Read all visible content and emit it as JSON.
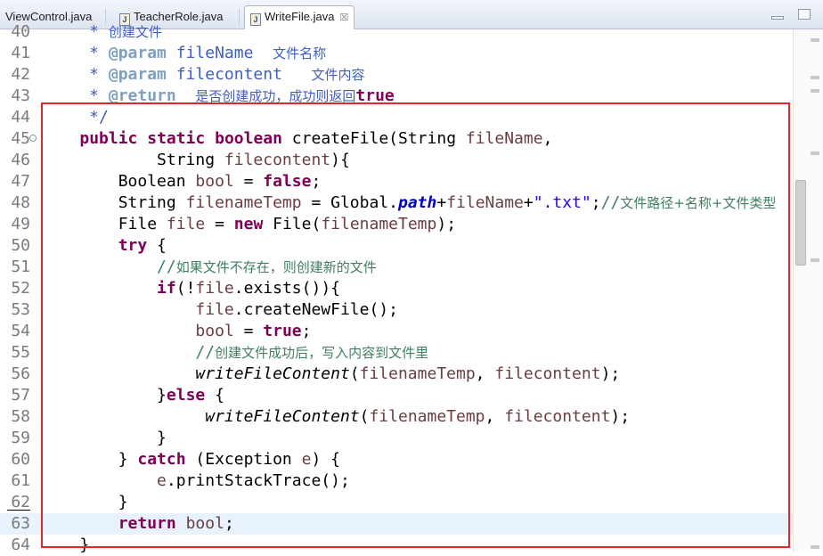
{
  "tabs": [
    {
      "label": "ViewControl.java"
    },
    {
      "label": "TeacherRole.java"
    },
    {
      "label": "WriteFile.java",
      "close": "☒"
    }
  ],
  "lines": [
    {
      "num": "40",
      "parts": [
        {
          "c": "doc",
          "t": "     * "
        },
        {
          "c": "dtxt",
          "t": "创建文件"
        }
      ]
    },
    {
      "num": "41",
      "parts": [
        {
          "c": "doc",
          "t": "     * "
        },
        {
          "c": "dtag",
          "t": "@param"
        },
        {
          "c": "doc",
          "t": " fileName  "
        },
        {
          "c": "dtxt",
          "t": "文件名称"
        }
      ]
    },
    {
      "num": "42",
      "parts": [
        {
          "c": "doc",
          "t": "     * "
        },
        {
          "c": "dtag",
          "t": "@param"
        },
        {
          "c": "doc",
          "t": " filecontent   "
        },
        {
          "c": "dtxt",
          "t": "文件内容"
        }
      ]
    },
    {
      "num": "43",
      "parts": [
        {
          "c": "doc",
          "t": "     * "
        },
        {
          "c": "dtag",
          "t": "@return"
        },
        {
          "c": "doc",
          "t": "  "
        },
        {
          "c": "dtxt",
          "t": "是否创建成功，成功则返回"
        },
        {
          "c": "kw",
          "t": "true"
        }
      ]
    },
    {
      "num": "44",
      "parts": [
        {
          "c": "doc",
          "t": "     */"
        }
      ]
    },
    {
      "num": "45",
      "fold": "⊖",
      "parts": [
        {
          "c": "",
          "t": "    "
        },
        {
          "c": "kw",
          "t": "public"
        },
        {
          "c": "",
          "t": " "
        },
        {
          "c": "kw",
          "t": "static"
        },
        {
          "c": "",
          "t": " "
        },
        {
          "c": "kw",
          "t": "boolean"
        },
        {
          "c": "",
          "t": " createFile(String "
        },
        {
          "c": "param",
          "t": "fileName"
        },
        {
          "c": "",
          "t": ","
        }
      ]
    },
    {
      "num": "46",
      "parts": [
        {
          "c": "",
          "t": "            String "
        },
        {
          "c": "param",
          "t": "filecontent"
        },
        {
          "c": "",
          "t": "){"
        }
      ]
    },
    {
      "num": "47",
      "parts": [
        {
          "c": "",
          "t": "        Boolean "
        },
        {
          "c": "param",
          "t": "bool"
        },
        {
          "c": "",
          "t": " = "
        },
        {
          "c": "kw",
          "t": "false"
        },
        {
          "c": "",
          "t": ";"
        }
      ]
    },
    {
      "num": "48",
      "parts": [
        {
          "c": "",
          "t": "        String "
        },
        {
          "c": "param",
          "t": "filenameTemp"
        },
        {
          "c": "",
          "t": " = Global."
        },
        {
          "c": "field",
          "t": "path"
        },
        {
          "c": "",
          "t": "+"
        },
        {
          "c": "param",
          "t": "fileName"
        },
        {
          "c": "",
          "t": "+"
        },
        {
          "c": "str",
          "t": "\".txt\""
        },
        {
          "c": "",
          "t": ";"
        },
        {
          "c": "cmtm",
          "t": "//"
        },
        {
          "c": "cmt",
          "t": "文件路径+名称+文件类型"
        }
      ]
    },
    {
      "num": "49",
      "parts": [
        {
          "c": "",
          "t": "        File "
        },
        {
          "c": "param",
          "t": "file"
        },
        {
          "c": "",
          "t": " = "
        },
        {
          "c": "kw",
          "t": "new"
        },
        {
          "c": "",
          "t": " File("
        },
        {
          "c": "param",
          "t": "filenameTemp"
        },
        {
          "c": "",
          "t": ");"
        }
      ]
    },
    {
      "num": "50",
      "parts": [
        {
          "c": "",
          "t": "        "
        },
        {
          "c": "kw",
          "t": "try"
        },
        {
          "c": "",
          "t": " {"
        }
      ]
    },
    {
      "num": "51",
      "parts": [
        {
          "c": "cmtm",
          "t": "            //"
        },
        {
          "c": "cmt",
          "t": "如果文件不存在，则创建新的文件"
        }
      ]
    },
    {
      "num": "52",
      "parts": [
        {
          "c": "",
          "t": "            "
        },
        {
          "c": "kw",
          "t": "if"
        },
        {
          "c": "",
          "t": "(!"
        },
        {
          "c": "param",
          "t": "file"
        },
        {
          "c": "",
          "t": ".exists()){"
        }
      ]
    },
    {
      "num": "53",
      "parts": [
        {
          "c": "",
          "t": "                "
        },
        {
          "c": "param",
          "t": "file"
        },
        {
          "c": "",
          "t": ".createNewFile();"
        }
      ]
    },
    {
      "num": "54",
      "parts": [
        {
          "c": "",
          "t": "                "
        },
        {
          "c": "param",
          "t": "bool"
        },
        {
          "c": "",
          "t": " = "
        },
        {
          "c": "kw",
          "t": "true"
        },
        {
          "c": "",
          "t": ";"
        }
      ]
    },
    {
      "num": "55",
      "parts": [
        {
          "c": "cmtm",
          "t": "                //"
        },
        {
          "c": "cmt",
          "t": "创建文件成功后，写入内容到文件里"
        }
      ]
    },
    {
      "num": "56",
      "parts": [
        {
          "c": "",
          "t": "                "
        },
        {
          "c": "imeth",
          "t": "writeFileContent"
        },
        {
          "c": "",
          "t": "("
        },
        {
          "c": "param",
          "t": "filenameTemp"
        },
        {
          "c": "",
          "t": ", "
        },
        {
          "c": "param",
          "t": "filecontent"
        },
        {
          "c": "",
          "t": ");"
        }
      ]
    },
    {
      "num": "57",
      "parts": [
        {
          "c": "",
          "t": "            }"
        },
        {
          "c": "kw",
          "t": "else"
        },
        {
          "c": "",
          "t": " {"
        }
      ]
    },
    {
      "num": "58",
      "parts": [
        {
          "c": "",
          "t": "                 "
        },
        {
          "c": "imeth",
          "t": "writeFileContent"
        },
        {
          "c": "",
          "t": "("
        },
        {
          "c": "param",
          "t": "filenameTemp"
        },
        {
          "c": "",
          "t": ", "
        },
        {
          "c": "param",
          "t": "filecontent"
        },
        {
          "c": "",
          "t": ");"
        }
      ]
    },
    {
      "num": "59",
      "parts": [
        {
          "c": "",
          "t": "            }"
        }
      ]
    },
    {
      "num": "60",
      "parts": [
        {
          "c": "",
          "t": "        } "
        },
        {
          "c": "kw",
          "t": "catch"
        },
        {
          "c": "",
          "t": " (Exception "
        },
        {
          "c": "param",
          "t": "e"
        },
        {
          "c": "",
          "t": ") {"
        }
      ]
    },
    {
      "num": "61",
      "parts": [
        {
          "c": "",
          "t": "            "
        },
        {
          "c": "param",
          "t": "e"
        },
        {
          "c": "",
          "t": ".printStackTrace();"
        }
      ]
    },
    {
      "num": "62",
      "parts": [
        {
          "c": "",
          "t": "        }"
        }
      ]
    },
    {
      "num": "63",
      "current": true,
      "parts": [
        {
          "c": "",
          "t": "        "
        },
        {
          "c": "kw",
          "t": "return"
        },
        {
          "c": "",
          "t": " "
        },
        {
          "c": "param",
          "t": "bool"
        },
        {
          "c": "",
          "t": ";"
        }
      ]
    },
    {
      "num": "64",
      "parts": [
        {
          "c": "",
          "t": "    }"
        }
      ]
    }
  ]
}
